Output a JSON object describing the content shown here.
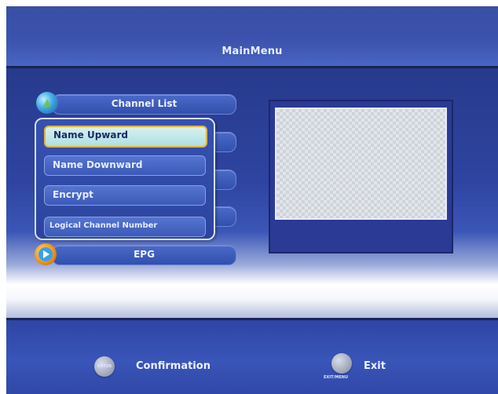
{
  "header": {
    "title": "MainMenu"
  },
  "main_menu": {
    "items": [
      {
        "label": "Channel List"
      },
      {
        "label": ""
      },
      {
        "label": ""
      },
      {
        "label": ""
      },
      {
        "label": "EPG"
      }
    ]
  },
  "submenu": {
    "items": [
      {
        "label": "Name Upward",
        "selected": true
      },
      {
        "label": "Name Downward",
        "selected": false
      },
      {
        "label": "Encrypt",
        "selected": false
      },
      {
        "label": "Logical Channel Number",
        "selected": false
      }
    ]
  },
  "footer": {
    "confirm": {
      "icon_text": "ENTER",
      "label": "Confirmation"
    },
    "exit": {
      "icon_text": "EXIT/MENU",
      "label": "Exit"
    }
  },
  "colors": {
    "header_blue": "#3b53ad",
    "panel_blue": "#2c449e",
    "highlight": "#aee0e0",
    "highlight_border": "#e3b43a"
  },
  "icons": [
    "globe-icon",
    "play-icon",
    "enter-button-icon",
    "exit-button-icon"
  ]
}
